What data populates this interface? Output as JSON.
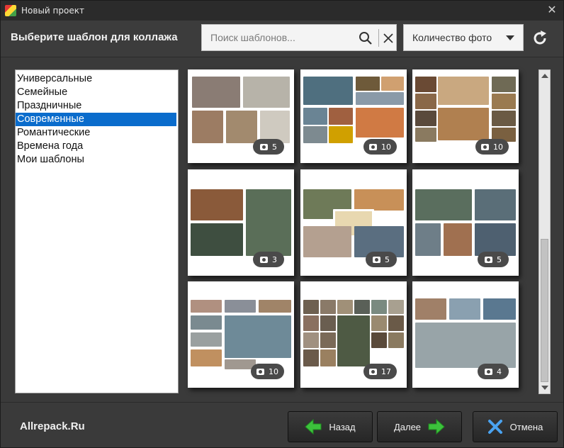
{
  "window": {
    "title": "Новый проект"
  },
  "toolbar": {
    "heading": "Выберите шаблон для коллажа",
    "search_placeholder": "Поиск шаблонов...",
    "photo_count_dropdown": "Количество фото"
  },
  "categories": [
    {
      "label": "Универсальные",
      "selected": false
    },
    {
      "label": "Семейные",
      "selected": false
    },
    {
      "label": "Праздничные",
      "selected": false
    },
    {
      "label": "Современные",
      "selected": true
    },
    {
      "label": "Романтические",
      "selected": false
    },
    {
      "label": "Времена года",
      "selected": false
    },
    {
      "label": "Мои шаблоны",
      "selected": false
    }
  ],
  "templates": [
    {
      "photo_count": "5"
    },
    {
      "photo_count": "10"
    },
    {
      "photo_count": "10"
    },
    {
      "photo_count": "3"
    },
    {
      "photo_count": "5"
    },
    {
      "photo_count": "5"
    },
    {
      "photo_count": "10"
    },
    {
      "photo_count": "17"
    },
    {
      "photo_count": "4"
    }
  ],
  "footer": {
    "watermark": "Allrepack.Ru",
    "back_label": "Назад",
    "next_label": "Далее",
    "cancel_label": "Отмена"
  },
  "icons": {
    "search": "search-icon",
    "clear": "close-icon",
    "refresh": "refresh-icon",
    "back": "arrow-left-icon",
    "next": "arrow-right-icon",
    "cancel": "x-icon",
    "camera": "camera-icon"
  },
  "colors": {
    "selection": "#0a6ccc",
    "arrow_green": "#3cc23c",
    "cancel_blue": "#4aa3f0"
  }
}
